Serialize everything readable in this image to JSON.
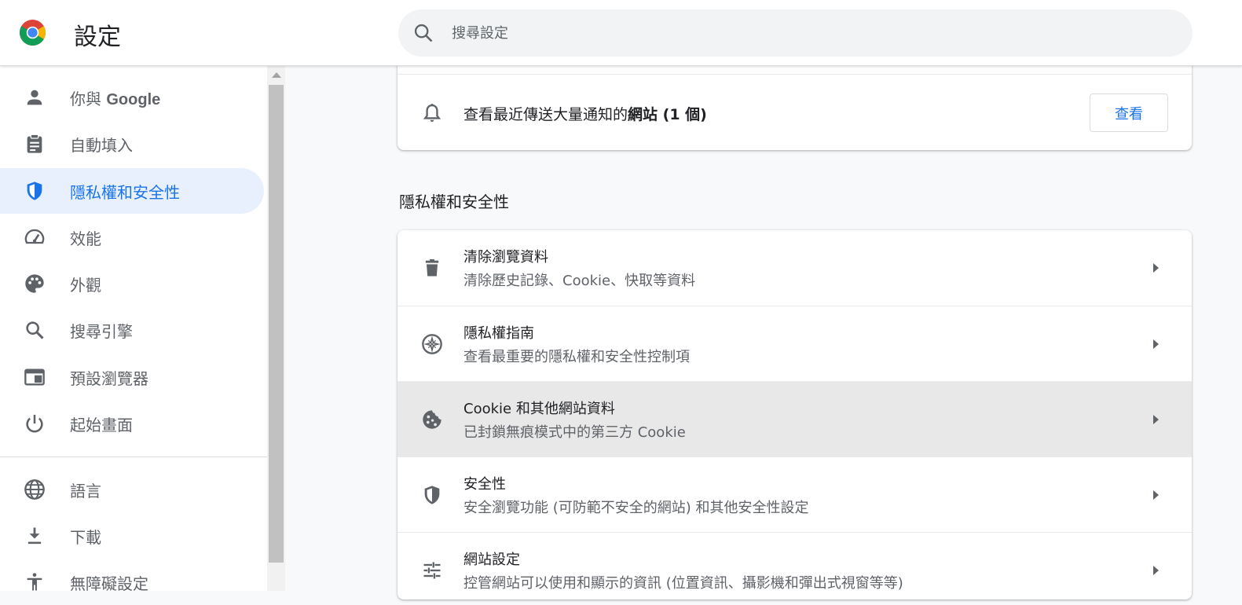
{
  "header": {
    "title": "設定",
    "search_placeholder": "搜尋設定"
  },
  "sidebar": {
    "items": [
      {
        "label_pre": "你與 ",
        "label_bold": "Google",
        "icon": "person-icon"
      },
      {
        "label": "自動填入",
        "icon": "clipboard-icon"
      },
      {
        "label": "隱私權和安全性",
        "icon": "shield-icon",
        "active": true
      },
      {
        "label": "效能",
        "icon": "speedometer-icon"
      },
      {
        "label": "外觀",
        "icon": "palette-icon"
      },
      {
        "label": "搜尋引擎",
        "icon": "search-icon"
      },
      {
        "label": "預設瀏覽器",
        "icon": "browser-window-icon"
      },
      {
        "label": "起始畫面",
        "icon": "power-icon"
      },
      {
        "label": "語言",
        "icon": "globe-icon"
      },
      {
        "label": "下載",
        "icon": "download-icon"
      },
      {
        "label": "無障礙設定",
        "icon": "accessibility-icon"
      }
    ]
  },
  "notification_card": {
    "text_pre": "查看最近傳送大量通知的",
    "text_bold": "網站 (1 個)",
    "button_label": "查看",
    "icon": "bell-icon"
  },
  "privacy_section": {
    "title": "隱私權和安全性",
    "rows": [
      {
        "title": "清除瀏覽資料",
        "subtitle": "清除歷史記錄、Cookie、快取等資料",
        "icon": "trash-icon"
      },
      {
        "title": "隱私權指南",
        "subtitle": "查看最重要的隱私權和安全性控制項",
        "icon": "compass-icon"
      },
      {
        "title": "Cookie 和其他網站資料",
        "subtitle": "已封鎖無痕模式中的第三方 Cookie",
        "icon": "cookie-icon",
        "hovered": true
      },
      {
        "title": "安全性",
        "subtitle": "安全瀏覽功能 (可防範不安全的網站) 和其他安全性設定",
        "icon": "security-shield-icon"
      },
      {
        "title": "網站設定",
        "subtitle": "控管網站可以使用和顯示的資訊 (位置資訊、攝影機和彈出式視窗等等)",
        "icon": "sliders-icon"
      }
    ]
  },
  "colors": {
    "accent": "#1a73e8",
    "active_bg": "#e8f0fe",
    "icon_gray": "#5f6368",
    "hover_row_bg": "#e8e8e8"
  }
}
